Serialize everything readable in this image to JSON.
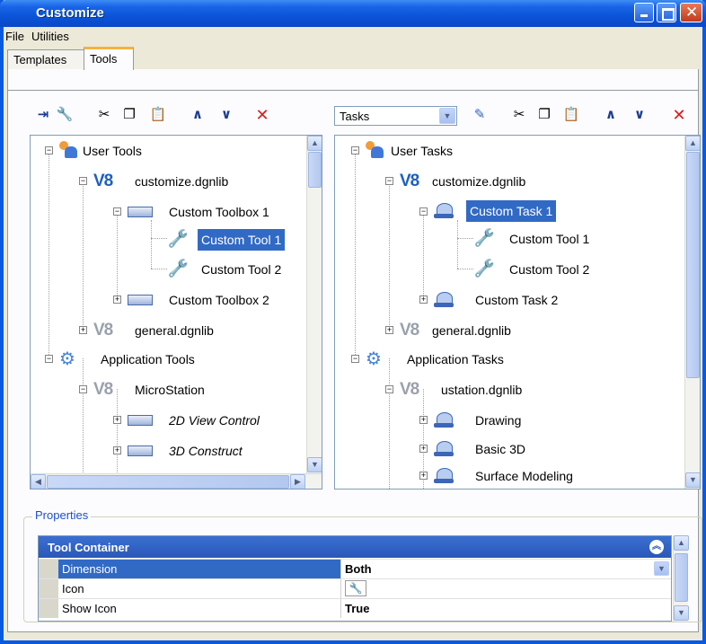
{
  "window": {
    "title": "Customize"
  },
  "menu": [
    "File",
    "Utilities"
  ],
  "tabs": [
    {
      "label": "Templates",
      "active": false
    },
    {
      "label": "Tools",
      "active": true
    }
  ],
  "left_toolbar": {
    "icons": [
      "insert-icon",
      "new-tool-icon",
      "cut-icon",
      "copy-icon",
      "paste-icon",
      "move-up-icon",
      "move-down-icon",
      "delete-icon"
    ]
  },
  "right_toolbar": {
    "combo_value": "Tasks",
    "icons": [
      "new-task-icon",
      "cut-icon",
      "copy-icon",
      "paste-icon",
      "move-up-icon",
      "move-down-icon",
      "delete-icon"
    ]
  },
  "left_tree": [
    {
      "label": "User Tools",
      "icon": "users-icon",
      "expander": "minus"
    },
    {
      "label": "customize.dgnlib",
      "icon": "v8-library-icon",
      "expander": "minus"
    },
    {
      "label": "Custom Toolbox 1",
      "icon": "toolbox-icon",
      "expander": "minus"
    },
    {
      "label": "Custom Tool 1",
      "icon": "wrench-icon",
      "selected": true
    },
    {
      "label": "Custom Tool 2",
      "icon": "wrench-icon"
    },
    {
      "label": "Custom Toolbox 2",
      "icon": "toolbox-icon",
      "expander": "plus"
    },
    {
      "label": "general.dgnlib",
      "icon": "v8-library-gray-icon",
      "expander": "plus"
    },
    {
      "label": "Application Tools",
      "icon": "gear-icon",
      "expander": "minus"
    },
    {
      "label": "MicroStation",
      "icon": "v8-library-gray-icon",
      "expander": "minus"
    },
    {
      "label": "2D View Control",
      "icon": "toolbox-icon",
      "expander": "plus",
      "italic": true
    },
    {
      "label": "3D Construct",
      "icon": "toolbox-icon",
      "expander": "plus",
      "italic": true
    }
  ],
  "right_tree": [
    {
      "label": "User Tasks",
      "icon": "users-icon",
      "expander": "minus"
    },
    {
      "label": "customize.dgnlib",
      "icon": "v8-library-icon",
      "expander": "minus"
    },
    {
      "label": "Custom Task 1",
      "icon": "task-icon",
      "expander": "minus",
      "selected": true
    },
    {
      "label": "Custom Tool 1",
      "icon": "wrench-icon"
    },
    {
      "label": "Custom Tool 2",
      "icon": "wrench-icon"
    },
    {
      "label": "Custom Task 2",
      "icon": "task-icon",
      "expander": "plus"
    },
    {
      "label": "general.dgnlib",
      "icon": "v8-library-gray-icon",
      "expander": "plus"
    },
    {
      "label": "Application Tasks",
      "icon": "app-tasks-icon",
      "expander": "minus"
    },
    {
      "label": "ustation.dgnlib",
      "icon": "v8-library-gray-icon",
      "expander": "minus"
    },
    {
      "label": "Drawing",
      "icon": "task-icon",
      "expander": "plus"
    },
    {
      "label": "Basic 3D",
      "icon": "task-icon",
      "expander": "plus"
    },
    {
      "label": "Surface Modeling",
      "icon": "task-icon",
      "expander": "plus"
    }
  ],
  "properties": {
    "group_title": "Properties",
    "section_title": "Tool Container",
    "rows": [
      {
        "name": "Dimension",
        "value": "Both",
        "selected": true,
        "editor": "dropdown"
      },
      {
        "name": "Icon",
        "value": "",
        "editor": "icon-preview"
      },
      {
        "name": "Show Icon",
        "value": "True",
        "editor": "text"
      }
    ]
  },
  "colors": {
    "titlebar": "#0a54d8",
    "selection": "#316ac5",
    "delete_icon": "#e01a1a",
    "group_title": "#1c4fd0"
  }
}
